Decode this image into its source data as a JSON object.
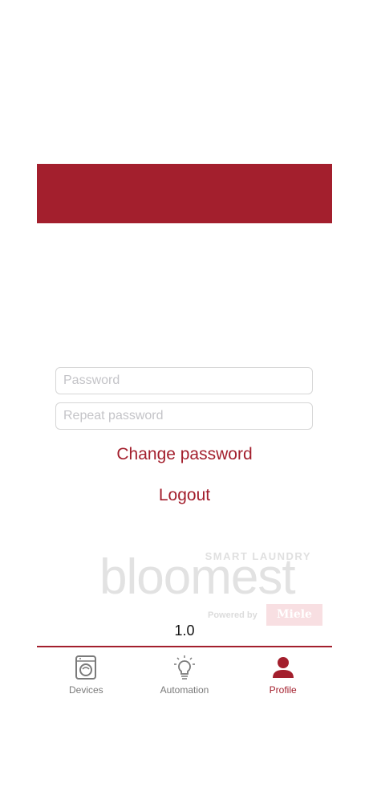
{
  "form": {
    "password_placeholder": "Password",
    "repeat_password_placeholder": "Repeat password"
  },
  "actions": {
    "change_password": "Change password",
    "logout": "Logout"
  },
  "logo": {
    "tagline": "SMART LAUNDRY",
    "wordmark": "bloomest",
    "powered_by": "Powered by",
    "brand": "Miele"
  },
  "version": "1.0",
  "tabs": [
    {
      "label": "Devices",
      "icon": "washing-machine-icon",
      "active": false
    },
    {
      "label": "Automation",
      "icon": "lightbulb-icon",
      "active": false
    },
    {
      "label": "Profile",
      "icon": "person-icon",
      "active": true
    }
  ],
  "colors": {
    "accent": "#a31f2d",
    "inactive": "#7a7a7a"
  }
}
